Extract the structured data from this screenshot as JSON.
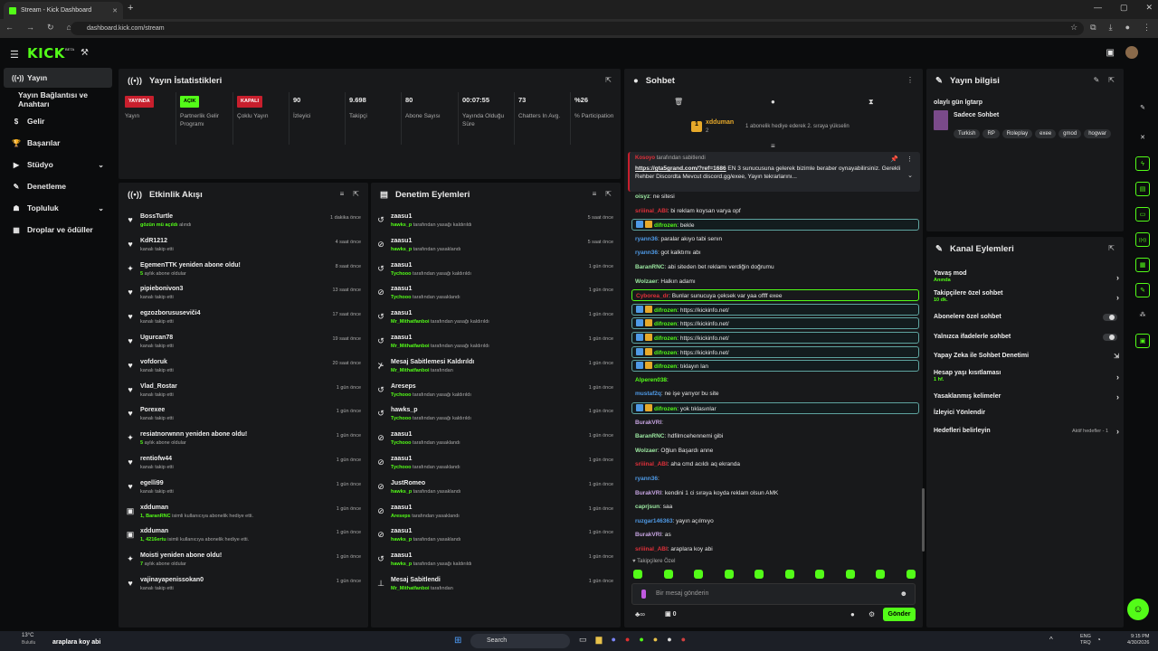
{
  "browser": {
    "tab_title": "Stream - Kick Dashboard",
    "url": "dashboard.kick.com/stream"
  },
  "header": {
    "logo": "KICK",
    "logo_beta": "BETA"
  },
  "sidebar": {
    "items": [
      {
        "label": "Yayın",
        "icon": "broadcast-icon",
        "active": true
      },
      {
        "label": "Yayın Bağlantısı ve Anahtarı",
        "icon": "",
        "active": false
      },
      {
        "label": "Gelir",
        "icon": "dollar-icon",
        "active": false
      },
      {
        "label": "Başarılar",
        "icon": "trophy-icon",
        "active": false
      },
      {
        "label": "Stüdyo",
        "icon": "video-icon",
        "active": false,
        "chevron": true
      },
      {
        "label": "Denetleme",
        "icon": "wrench-icon",
        "active": false
      },
      {
        "label": "Topluluk",
        "icon": "people-icon",
        "active": false,
        "chevron": true
      },
      {
        "label": "Droplar ve ödüller",
        "icon": "grid-icon",
        "active": false
      }
    ]
  },
  "stats": {
    "title": "Yayın İstatistikleri",
    "items": [
      {
        "value": "YAYINDA",
        "label": "Yayın",
        "badge": true,
        "color": "#c81f2d"
      },
      {
        "value": "AÇIK",
        "label": "Partnerlik Gelir Programı",
        "badge": true,
        "color": "#53fc18"
      },
      {
        "value": "KAPALI",
        "label": "Çoklu Yayın",
        "badge": true,
        "color": "#c81f2d"
      },
      {
        "value": "90",
        "label": "İzleyici"
      },
      {
        "value": "9.698",
        "label": "Takipçi"
      },
      {
        "value": "80",
        "label": "Abone Sayısı"
      },
      {
        "value": "00:07:55",
        "label": "Yayında Olduğu Süre"
      },
      {
        "value": "73",
        "label": "Chatters In Avg."
      },
      {
        "value": "%26",
        "label": "% Participation"
      }
    ]
  },
  "activity": {
    "title": "Etkinlik Akışı",
    "rows": [
      {
        "icon": "heart-icon",
        "name": "BossTurtle",
        "sub": "gözün mü açıldı",
        "sub2": " alındı",
        "time": "1 dakika önce"
      },
      {
        "icon": "heart-icon",
        "name": "KdR1212",
        "sub": "",
        "sub2": "kanalı takip etti",
        "time": "4 saat önce"
      },
      {
        "icon": "star-icon",
        "name": "EgemenTTK yeniden abone oldu!",
        "sub": "5",
        "sub2": " aylık abone oldular",
        "time": "8 saat önce"
      },
      {
        "icon": "heart-icon",
        "name": "pipiebonivon3",
        "sub": "",
        "sub2": "kanalı takip etti",
        "time": "13 saat önce"
      },
      {
        "icon": "heart-icon",
        "name": "egzozborususeviči4",
        "sub": "",
        "sub2": "kanalı takip etti",
        "time": "17 saat önce"
      },
      {
        "icon": "heart-icon",
        "name": "Ugurcan78",
        "sub": "",
        "sub2": "kanalı takip etti",
        "time": "19 saat önce"
      },
      {
        "icon": "heart-icon",
        "name": "vofdoruk",
        "sub": "",
        "sub2": "kanalı takip etti",
        "time": "20 saat önce"
      },
      {
        "icon": "heart-icon",
        "name": "Vlad_Rostar",
        "sub": "",
        "sub2": "kanalı takip etti",
        "time": "1 gün önce"
      },
      {
        "icon": "heart-icon",
        "name": "Porexee",
        "sub": "",
        "sub2": "kanalı takip etti",
        "time": "1 gün önce"
      },
      {
        "icon": "star-icon",
        "name": "resiatnorwnnn yeniden abone oldu!",
        "sub": "5",
        "sub2": " aylık abone oldular",
        "time": "1 gün önce"
      },
      {
        "icon": "heart-icon",
        "name": "rentiofw44",
        "sub": "",
        "sub2": "kanalı takip etti",
        "time": "1 gün önce"
      },
      {
        "icon": "heart-icon",
        "name": "egelli99",
        "sub": "",
        "sub2": "kanalı takip etti",
        "time": "1 gün önce"
      },
      {
        "icon": "gift-icon",
        "name": "xdduman",
        "sub": "1, BaranRNC",
        "sub2": " isimli kullanıcıya abonelik hediye etti.",
        "time": "1 gün önce"
      },
      {
        "icon": "gift-icon",
        "name": "xdduman",
        "sub": "1, 4216ertu",
        "sub2": " isimli kullanıcıya abonelik hediye etti.",
        "time": "1 gün önce"
      },
      {
        "icon": "star-icon",
        "name": "Moisti yeniden abone oldu!",
        "sub": "7",
        "sub2": " aylık abone oldular",
        "time": "1 gün önce"
      },
      {
        "icon": "heart-icon",
        "name": "vajinayapenissokan0",
        "sub": "",
        "sub2": "kanalı takip etti",
        "time": "1 gün önce"
      }
    ]
  },
  "moderation": {
    "title": "Denetim Eylemleri",
    "rows": [
      {
        "icon": "undo-icon",
        "name": "zaasu1",
        "sub": "hawks_p",
        "sub2": " tarafından yasağı kaldırıldı",
        "time": "5 saat önce"
      },
      {
        "icon": "ban-icon",
        "name": "zaasu1",
        "sub": "hawks_p",
        "sub2": " tarafından yasaklandı",
        "time": "5 saat önce"
      },
      {
        "icon": "undo-icon",
        "name": "zaasu1",
        "sub": "Tychooo",
        "sub2": " tarafından yasağı kaldırıldı",
        "time": "1 gün önce"
      },
      {
        "icon": "ban-icon",
        "name": "zaasu1",
        "sub": "Tychooo",
        "sub2": " tarafından yasaklandı",
        "time": "1 gün önce"
      },
      {
        "icon": "undo-icon",
        "name": "zaasu1",
        "sub": "Mr_Mithatfanboi",
        "sub2": " tarafından yasağı kaldırıldı",
        "time": "1 gün önce"
      },
      {
        "icon": "undo-icon",
        "name": "zaasu1",
        "sub": "Mr_Mithatfanboi",
        "sub2": " tarafından yasağı kaldırıldı",
        "time": "1 gün önce"
      },
      {
        "icon": "unpin-icon",
        "name": "Mesaj Sabitlemesi Kaldırıldı",
        "sub": "Mr_Mithatfanboi",
        "sub2": " tarafından",
        "time": "1 gün önce"
      },
      {
        "icon": "undo-icon",
        "name": "Areseps",
        "sub": "Tychooo",
        "sub2": " tarafından yasağı kaldırıldı",
        "time": "1 gün önce"
      },
      {
        "icon": "undo-icon",
        "name": "hawks_p",
        "sub": "Tychooo",
        "sub2": " tarafından yasağı kaldırıldı",
        "time": "1 gün önce"
      },
      {
        "icon": "ban-icon",
        "name": "zaasu1",
        "sub": "Tychooo",
        "sub2": " tarafından yasaklandı",
        "time": "1 gün önce"
      },
      {
        "icon": "ban-icon",
        "name": "zaasu1",
        "sub": "Tychooo",
        "sub2": " tarafından yasaklandı",
        "time": "1 gün önce"
      },
      {
        "icon": "ban-icon",
        "name": "JustRomeo",
        "sub": "hawks_p",
        "sub2": " tarafından yasaklandı",
        "time": "1 gün önce"
      },
      {
        "icon": "ban-icon",
        "name": "zaasu1",
        "sub": "Areseps",
        "sub2": " tarafından yasaklandı",
        "time": "1 gün önce"
      },
      {
        "icon": "ban-icon",
        "name": "zaasu1",
        "sub": "hawks_p",
        "sub2": " tarafından yasaklandı",
        "time": "1 gün önce"
      },
      {
        "icon": "undo-icon",
        "name": "zaasu1",
        "sub": "hawks_p",
        "sub2": " tarafından yasağı kaldırıldı",
        "time": "1 gün önce"
      },
      {
        "icon": "pin-icon",
        "name": "Mesaj Sabitlendi",
        "sub": "Mr_Mithatfanboi",
        "sub2": " tarafından",
        "time": "1 gün önce"
      }
    ]
  },
  "chat": {
    "title": "Sohbet",
    "top_user": "xdduman",
    "top_user_count": "2",
    "top_text": "1 abonelik hediye ederek 2. sıraya yükselin",
    "pinned_by": "tarafından sabitlendi",
    "pinned_link": "https://gta5grand.com/?ref=1686",
    "pinned_text": " EN 3 sunucusuna gelerek bizimle beraber oynayabilirsiniz. Gerekli Rehber Discordta Mevcut discord.gg/exee, Yayın tekrarlarını...",
    "messages": [
      {
        "user": "oisyz",
        "color": "#9be6a0",
        "text": " ne sitesi",
        "hl": ""
      },
      {
        "user": "sriiinal_ABI",
        "color": "#e0303a",
        "text": " bi reklam koysan varya opf",
        "hl": ""
      },
      {
        "user": "difrozen",
        "color": "#53fc18",
        "text": " bekle",
        "hl": "hl"
      },
      {
        "user": "ryann36",
        "color": "#4f9ae6",
        "text": " paralar akıyo tabi senın",
        "hl": ""
      },
      {
        "user": "ryann36",
        "color": "#4f9ae6",
        "text": " got kalktımı abı",
        "hl": ""
      },
      {
        "user": "BaranRNC",
        "color": "#9be6a0",
        "text": " abi siteden bet reklamı verdiğin doğrumu",
        "hl": ""
      },
      {
        "user": "Wolzaer",
        "color": "#9be6a0",
        "text": " Halkın adamı",
        "hl": ""
      },
      {
        "user": "Cyborea_dr",
        "color": "#e0303a",
        "text": " Bunlar sunucuya çeksek var yaa offff exee",
        "hl": "hlg"
      },
      {
        "user": "difrozen",
        "color": "#53fc18",
        "text": " https://kickinfo.net/",
        "hl": "hl"
      },
      {
        "user": "difrozen",
        "color": "#53fc18",
        "text": " https://kickinfo.net/",
        "hl": "hl"
      },
      {
        "user": "difrozen",
        "color": "#53fc18",
        "text": " https://kickinfo.net/",
        "hl": "hl"
      },
      {
        "user": "difrozen",
        "color": "#53fc18",
        "text": " https://kickinfo.net/",
        "hl": "hl"
      },
      {
        "user": "difrozen",
        "color": "#53fc18",
        "text": " tıklayın lan",
        "hl": "hl"
      },
      {
        "user": "Alperen038",
        "color": "#53fc18",
        "text": " ",
        "hl": ""
      },
      {
        "user": "mustaf2q",
        "color": "#4f9ae6",
        "text": " ne işe yarıyor bu site",
        "hl": ""
      },
      {
        "user": "difrozen",
        "color": "#53fc18",
        "text": " yok tıklasınlar",
        "hl": "hl"
      },
      {
        "user": "BurakVRl",
        "color": "#c5a3e0",
        "text": " ",
        "hl": ""
      },
      {
        "user": "BaranRNC",
        "color": "#9be6a0",
        "text": " hdfilmcehennemi gibi",
        "hl": ""
      },
      {
        "user": "Wolzaer",
        "color": "#9be6a0",
        "text": " Oğlun Başardı anne",
        "hl": ""
      },
      {
        "user": "sriiinal_ABI",
        "color": "#e0303a",
        "text": " aha cmd acıldı aq ekranda",
        "hl": ""
      },
      {
        "user": "ryann36",
        "color": "#4f9ae6",
        "text": " ",
        "hl": ""
      },
      {
        "user": "BurakVRl",
        "color": "#c5a3e0",
        "text": " kendini 1 ci sıraya koyda reklam olsun AMK",
        "hl": ""
      },
      {
        "user": "caprjsun",
        "color": "#9be6a0",
        "text": " saa",
        "hl": ""
      },
      {
        "user": "ruzgar146363",
        "color": "#4f9ae6",
        "text": " yayın açılmıyo",
        "hl": ""
      },
      {
        "user": "BurakVRl",
        "color": "#c5a3e0",
        "text": " as",
        "hl": ""
      },
      {
        "user": "sriiinal_ABI",
        "color": "#e0303a",
        "text": " araplara koy abi",
        "hl": ""
      }
    ],
    "followers_only": "Takipçilere Özel",
    "input_placeholder": "Bir mesaj gönderin",
    "points": "0",
    "send_label": "Gönder"
  },
  "info": {
    "title": "Yayın bilgisi",
    "stream_title": "olaylı gün lgtarp",
    "category": "Sadece Sohbet",
    "tags": [
      "Turkish",
      "RP",
      "Roleplay",
      "exee",
      "gmod",
      "hogwar"
    ]
  },
  "actions": {
    "title": "Kanal Eylemleri",
    "items": [
      {
        "label": "Yavaş mod",
        "sub": "Anında",
        "type": "arrow"
      },
      {
        "label": "Takipçilere özel sohbet",
        "sub": "10 dk.",
        "type": "arrow"
      },
      {
        "label": "Abonelere özel sohbet",
        "sub": "",
        "type": "toggle"
      },
      {
        "label": "Yalnızca ifadelerle sohbet",
        "sub": "",
        "type": "toggle"
      },
      {
        "label": "Yapay Zeka ile Sohbet Denetimi",
        "sub": "",
        "type": "external"
      },
      {
        "label": "Hesap yaşı kısıtlaması",
        "sub": "1 hf.",
        "type": "arrow"
      },
      {
        "label": "Yasaklanmış kelimeler",
        "sub": "",
        "type": "arrow"
      },
      {
        "label": "İzleyici Yönlendir",
        "sub": "",
        "type": "none"
      },
      {
        "label": "Hedefleri belirleyin",
        "sub": "",
        "type": "arrow",
        "extra": "Aktif hedefler - 1"
      }
    ]
  },
  "taskbar": {
    "weather": "13°C",
    "weather_sub": "Bulutlu",
    "ticker": "araplara koy abi",
    "search": "Search",
    "lang": "ENG",
    "lang2": "TRQ",
    "time": "9:15 PM",
    "date": "4/30/2026"
  }
}
